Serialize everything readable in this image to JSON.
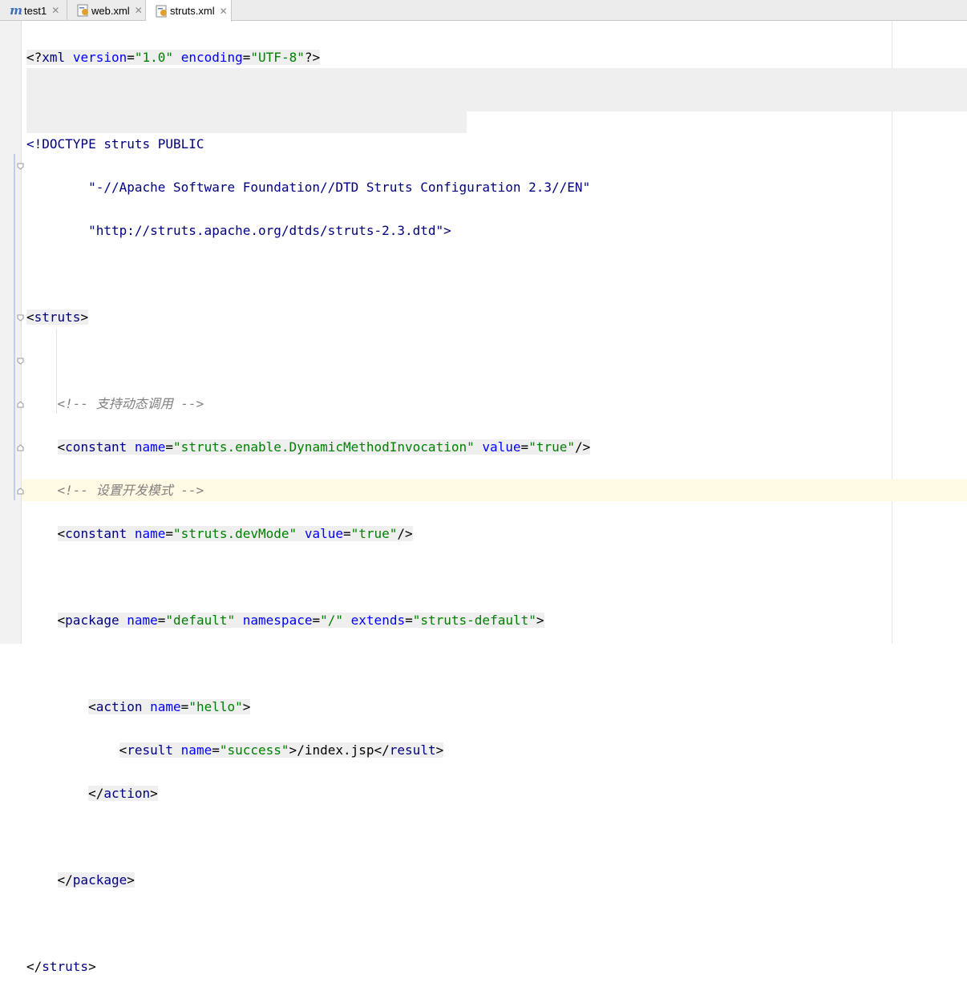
{
  "tabs": [
    {
      "label": "test1",
      "icon": "maven-module-icon",
      "active": false
    },
    {
      "label": "web.xml",
      "icon": "xml-file-icon",
      "active": false
    },
    {
      "label": "struts.xml",
      "icon": "xml-file-icon",
      "active": true
    }
  ],
  "editor": {
    "xml_decl": {
      "open": "<?",
      "name": "xml",
      "attr1": "version",
      "val1": "\"1.0\"",
      "attr2": "encoding",
      "val2": "\"UTF-8\"",
      "close": "?>"
    },
    "doctype": {
      "line1": "<!DOCTYPE struts PUBLIC",
      "line2": "\"-//Apache Software Foundation//DTD Struts Configuration 2.3//EN\"",
      "line3": "\"http://struts.apache.org/dtds/struts-2.3.dtd\">"
    },
    "struts_tag": "struts",
    "comment1": "<!-- 支持动态调用 -->",
    "constant1": {
      "tag": "constant",
      "attr_name": "name",
      "name_val": "\"struts.enable.DynamicMethodInvocation\"",
      "attr_value": "value",
      "value_val": "\"true\""
    },
    "comment2": "<!-- 设置开发模式 -->",
    "constant2": {
      "tag": "constant",
      "attr_name": "name",
      "name_val": "\"struts.devMode\"",
      "attr_value": "value",
      "value_val": "\"true\""
    },
    "package": {
      "tag": "package",
      "attr_name": "name",
      "name_val": "\"default\"",
      "attr_ns": "namespace",
      "ns_val": "\"/\"",
      "attr_ext": "extends",
      "ext_val": "\"struts-default\""
    },
    "action": {
      "tag": "action",
      "attr_name": "name",
      "name_val": "\"hello\""
    },
    "result": {
      "tag": "result",
      "attr_name": "name",
      "name_val": "\"success\"",
      "text": "/index.jsp"
    }
  }
}
